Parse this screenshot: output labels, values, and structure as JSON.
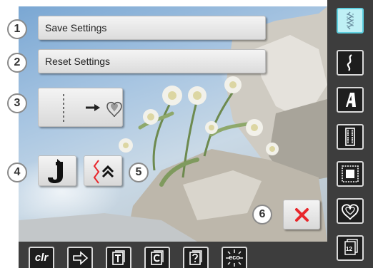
{
  "menu": {
    "save": {
      "number": "1",
      "label": "Save Settings"
    },
    "reset": {
      "number": "2",
      "label": "Reset Settings"
    },
    "stitch_to_heart": {
      "number": "3"
    },
    "needle_stop": {
      "number": "4"
    },
    "securing": {
      "number": "5"
    },
    "close": {
      "number": "6"
    }
  },
  "bottom_toolbar": {
    "clr_label": "clr",
    "eco_label": "eco",
    "icons": [
      "clr-icon",
      "arrow-right-icon",
      "tutorial-icon",
      "creative-consultant-icon",
      "help-icon",
      "eco-icon"
    ]
  },
  "right_sidebar": {
    "icons": [
      "practical-stitches-icon",
      "decorative-stitches-icon",
      "alphabets-icon",
      "buttonholes-icon",
      "quilt-stitches-icon",
      "personal-program-icon",
      "memory-icon"
    ],
    "active_index": 0,
    "memory_badge": "12"
  },
  "colors": {
    "active_tab": "#bff0f5",
    "close_x": "#e8262b",
    "toolbar": "#3d3d3d"
  }
}
